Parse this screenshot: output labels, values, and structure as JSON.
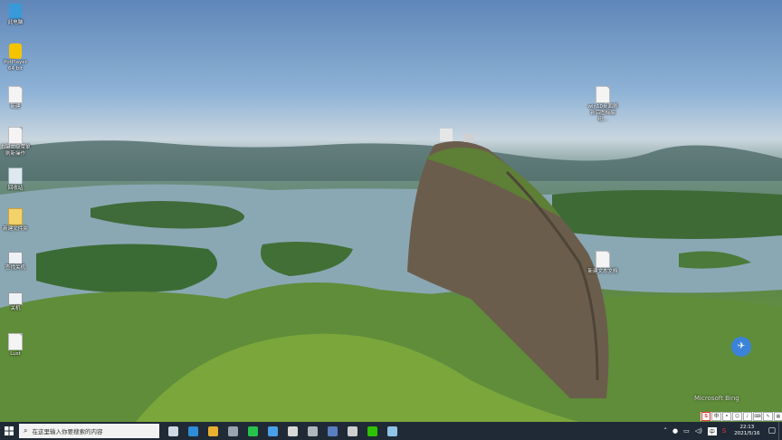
{
  "desktop": {
    "icons_left": [
      {
        "label": "此电脑",
        "icon": "computer-icon"
      },
      {
        "label": "PotPlayer 64 bit",
        "icon": "potplayer-icon"
      },
      {
        "label": "新建",
        "icon": "document-icon"
      },
      {
        "label": "右键二级菜单 刷新操作",
        "icon": "document-icon"
      },
      {
        "label": "回收站",
        "icon": "recycle-bin-icon"
      },
      {
        "label": "新建文件夹",
        "icon": "folder-icon"
      },
      {
        "label": "查找关机",
        "icon": "shortcut-icon"
      },
      {
        "label": "关机",
        "icon": "shortcut-icon"
      },
      {
        "label": "Lust",
        "icon": "document-icon"
      }
    ],
    "icons_right": [
      {
        "label": "win10桌面刷新后图标编组...",
        "icon": "document-icon"
      },
      {
        "label": "新建文本文档",
        "icon": "document-icon"
      }
    ],
    "watermark": "Microsoft Bing"
  },
  "taskbar": {
    "search_placeholder": "在这里输入你要搜索的内容",
    "pinned": [
      {
        "name": "task-view-icon",
        "color": "#cfd8e3"
      },
      {
        "name": "edge-icon",
        "color": "#2e8dd6"
      },
      {
        "name": "chrome-icon",
        "color": "#e8b02e"
      },
      {
        "name": "clock-app-icon",
        "color": "#9aa4ae"
      },
      {
        "name": "arrow-app-icon",
        "color": "#27c24c"
      },
      {
        "name": "browser-icon",
        "color": "#4aa0e8"
      },
      {
        "name": "mail-icon",
        "color": "#d9d9d9"
      },
      {
        "name": "camera-icon",
        "color": "#b0b6bd"
      },
      {
        "name": "terminal-icon",
        "color": "#5a7ec2"
      },
      {
        "name": "calculator-icon",
        "color": "#cfcfcf"
      },
      {
        "name": "wechat-icon",
        "color": "#2dc100"
      },
      {
        "name": "pen-app-icon",
        "color": "#8fc3e8"
      }
    ],
    "tray": {
      "time": "22:13",
      "date": "2021/5/16",
      "ime_label": "中"
    }
  }
}
